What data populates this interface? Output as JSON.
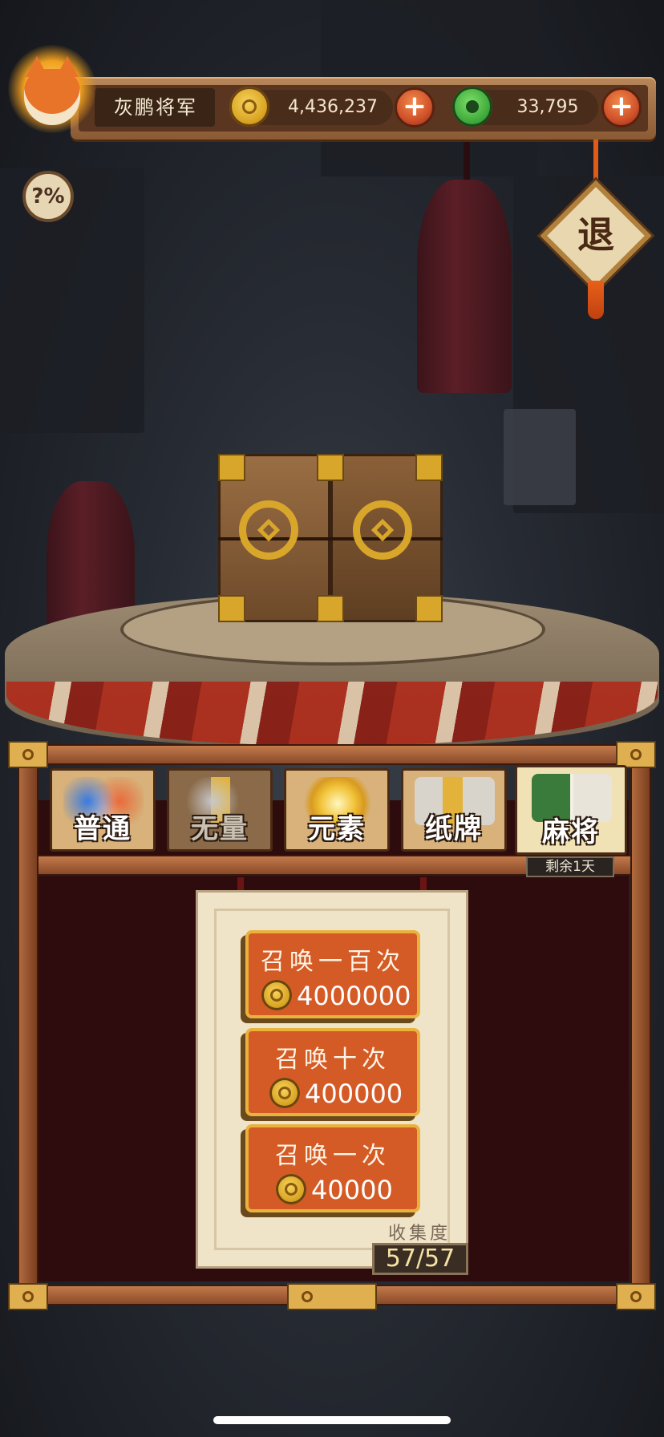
{
  "player": {
    "name": "灰鹏将军"
  },
  "currencies": {
    "gold": {
      "icon": "gold-coin-icon",
      "value": "4,436,237"
    },
    "jade": {
      "icon": "jade-coin-icon",
      "value": "33,795"
    }
  },
  "buttons": {
    "add_symbol": "+",
    "help_label": "?%",
    "exit_label": "退"
  },
  "tabs": [
    {
      "label": "普通",
      "icon": "mouse-icon",
      "state": "available"
    },
    {
      "label": "无量",
      "icon": "ox-seal-icon",
      "state": "locked"
    },
    {
      "label": "元素",
      "icon": "sun-icon",
      "state": "available"
    },
    {
      "label": "纸牌",
      "icon": "cards-icon",
      "state": "available"
    },
    {
      "label": "麻将",
      "icon": "mahjong-icon",
      "state": "selected"
    }
  ],
  "event_badge": "剩余1天",
  "summon_options": [
    {
      "label": "召唤一百次",
      "cost": "4000000"
    },
    {
      "label": "召唤十次",
      "cost": "400000"
    },
    {
      "label": "召唤一次",
      "cost": "40000"
    }
  ],
  "collection": {
    "label": "收集度",
    "value": "57/57"
  },
  "colors": {
    "accent": "#d45a26",
    "gold": "#d8a62a",
    "jade": "#3ea83a",
    "panel": "#2e0b0c"
  }
}
